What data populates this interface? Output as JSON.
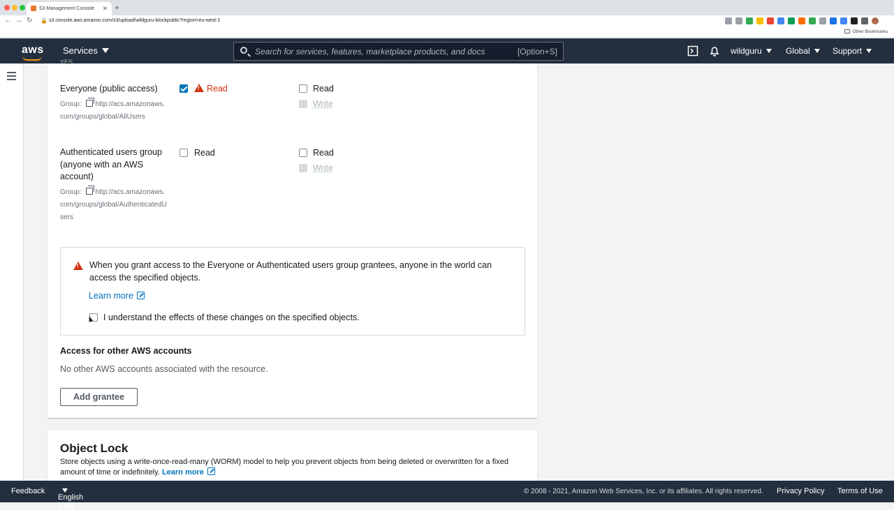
{
  "browser": {
    "tab_title": "S3 Management Console",
    "url": "s3.console.aws.amazon.com/s3/upload/wildguru-blockpublic?region=eu-west-1",
    "bookmarks_label": "Other Bookmarks"
  },
  "awsnav": {
    "logo": "aws",
    "services_label": "Services",
    "search_placeholder": "Search for services, features, marketplace products, and docs",
    "search_shortcut": "[Option+S]",
    "user": "wildguru",
    "region": "Global",
    "support": "Support"
  },
  "acl": {
    "cut_top_text": "YES",
    "everyone": {
      "name": "Everyone (public access)",
      "group_prefix": "Group:",
      "group_url": "http://acs.amazonaws.com/groups/global/AllUsers",
      "objects_read_label": "Read",
      "objects_read_checked": true,
      "acl_read_label": "Read",
      "acl_write_label": "Write"
    },
    "authenticated": {
      "name": "Authenticated users group (anyone with an AWS account)",
      "group_prefix": "Group:",
      "group_url": "http://acs.amazonaws.com/groups/global/AuthenticatedUsers",
      "objects_read_label": "Read",
      "acl_read_label": "Read",
      "acl_write_label": "Write"
    }
  },
  "alert": {
    "text": "When you grant access to the Everyone or Authenticated users group grantees, anyone in the world can access the specified objects.",
    "learn_more": "Learn more",
    "ack_label": "I understand the effects of these changes on the specified objects."
  },
  "other_accounts": {
    "title": "Access for other AWS accounts",
    "empty_text": "No other AWS accounts associated with the resource.",
    "add_button": "Add grantee"
  },
  "object_lock": {
    "title": "Object Lock",
    "description": "Store objects using a write-once-read-many (WORM) model to help you prevent objects from being deleted or overwritten for a fixed amount of time or indefinitely.",
    "learn_more": "Learn more"
  },
  "footer": {
    "feedback": "Feedback",
    "language": "English (US)",
    "copyright": "© 2008 - 2021, Amazon Web Services, Inc. or its affiliates. All rights reserved.",
    "privacy": "Privacy Policy",
    "terms": "Terms of Use"
  },
  "colors": {
    "nav_bg": "#232f3e",
    "accent_orange": "#ff9900",
    "link_blue": "#0073bb",
    "warning_red": "#d13212"
  }
}
